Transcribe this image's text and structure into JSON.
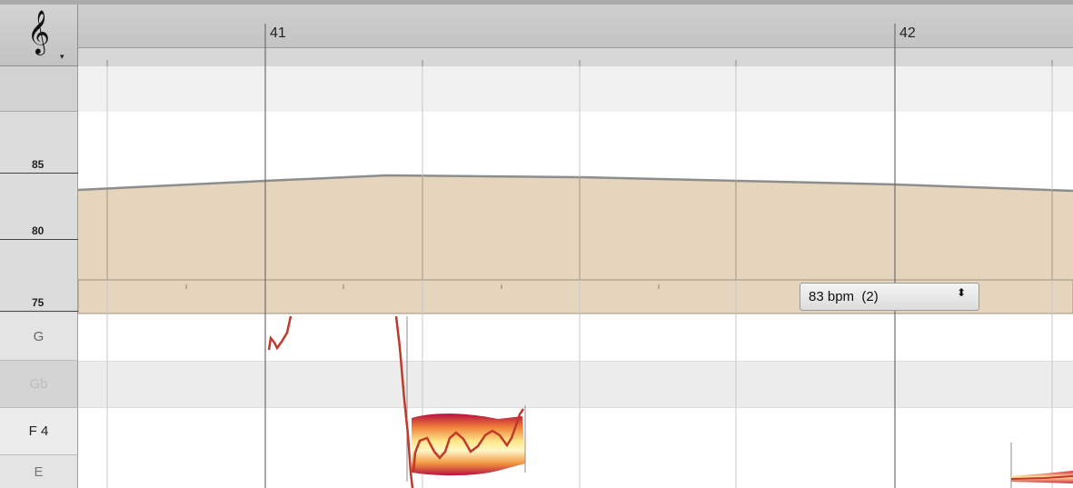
{
  "ruler": {
    "bars": [
      {
        "label": "41"
      },
      {
        "label": "42"
      }
    ]
  },
  "clef": {
    "glyph": "𝄞",
    "icon": "treble-clef-icon",
    "dropdown_glyph": "▾"
  },
  "tempo_scale": {
    "labels": [
      "85",
      "80",
      "75"
    ]
  },
  "pitch_rows": [
    {
      "label": "G",
      "shaded": false,
      "dim": false
    },
    {
      "label": "Gb",
      "shaded": true,
      "dim": true
    },
    {
      "label": "F 4",
      "shaded": false,
      "dim": false,
      "bold": true
    },
    {
      "label": "E",
      "shaded": false,
      "dim": false
    }
  ],
  "tempo_select": {
    "value": "83 bpm  (2)",
    "arrow_glyph": "⬍"
  },
  "colors": {
    "tempo_fill": "#e5d5bd",
    "tempo_line": "#8a8a8a",
    "blob_outer": "#c2144a",
    "blob_inner": "#ffe27a",
    "pitch_curve": "#c0392b"
  }
}
